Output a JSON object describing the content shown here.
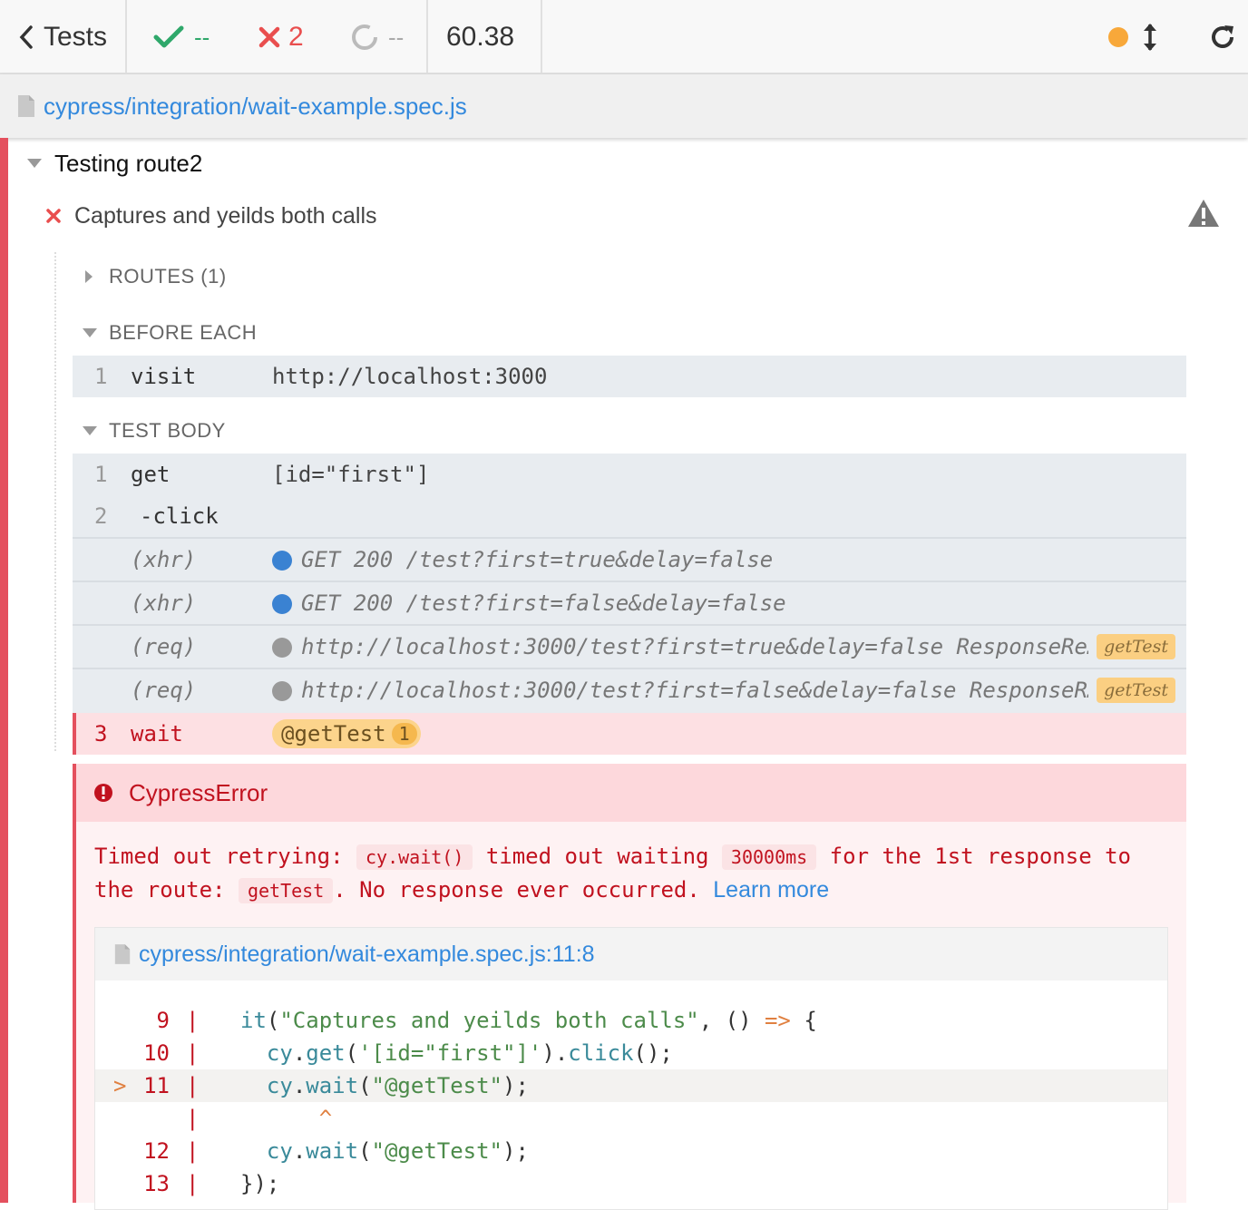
{
  "topbar": {
    "back_label": "Tests",
    "passed": "--",
    "failed": "2",
    "pending": "--",
    "duration": "60.38",
    "colors": {
      "passed": "#2fa86b",
      "failed": "#e94e4e",
      "status_dot": "#f8a83a"
    }
  },
  "spec": {
    "path": "cypress/integration/wait-example.spec.js"
  },
  "suite": {
    "title": "Testing route2"
  },
  "test": {
    "title": "Captures and yeilds both calls"
  },
  "sections": {
    "routes": "ROUTES (1)",
    "before_each": "BEFORE EACH",
    "test_body": "TEST BODY"
  },
  "before_each_commands": [
    {
      "num": "1",
      "name": "visit",
      "message": "http://localhost:3000"
    }
  ],
  "test_body_commands": [
    {
      "num": "1",
      "name": "get",
      "message": "[id=\"first\"]"
    },
    {
      "num": "2",
      "name": "-click",
      "message": ""
    },
    {
      "num": "",
      "name": "(xhr)",
      "message": "GET 200 /test?first=true&delay=false",
      "dot_color": "#3a82d2"
    },
    {
      "num": "",
      "name": "(xhr)",
      "message": "GET 200 /test?first=false&delay=false",
      "dot_color": "#3a82d2"
    },
    {
      "num": "",
      "name": "(req)",
      "message": "http://localhost:3000/test?first=true&delay=false ResponseRe…",
      "dot_color": "#999999",
      "alias": "getTest"
    },
    {
      "num": "",
      "name": "(req)",
      "message": "http://localhost:3000/test?first=false&delay=false ResponseR…",
      "dot_color": "#999999",
      "alias": "getTest"
    },
    {
      "num": "3",
      "name": "wait",
      "alias": "@getTest",
      "alias_count": "1"
    }
  ],
  "error": {
    "name": "CypressError",
    "msg_part1": "Timed out retrying:",
    "code1": "cy.wait()",
    "msg_part2": "timed out waiting",
    "code2": "30000ms",
    "msg_part3": "for the 1st response to the route:",
    "code3": "getTest",
    "msg_part4": ". No response ever occurred.",
    "learn_more": "Learn more",
    "file": "cypress/integration/wait-example.spec.js:11:8",
    "code_lines": [
      {
        "num": "9",
        "bar": "|",
        "code": "it(\"Captures and yeilds both calls\", () => {"
      },
      {
        "num": "10",
        "bar": "|",
        "code": "  cy.get('[id=\"first\"]').click();"
      },
      {
        "num": "11",
        "arrow": ">",
        "bar": "|",
        "code": "  cy.wait(\"@getTest\");"
      },
      {
        "num": "",
        "bar": "|",
        "code": "      ^"
      },
      {
        "num": "12",
        "bar": "|",
        "code": "  cy.wait(\"@getTest\");"
      },
      {
        "num": "13",
        "bar": "|",
        "code": "});"
      }
    ]
  }
}
